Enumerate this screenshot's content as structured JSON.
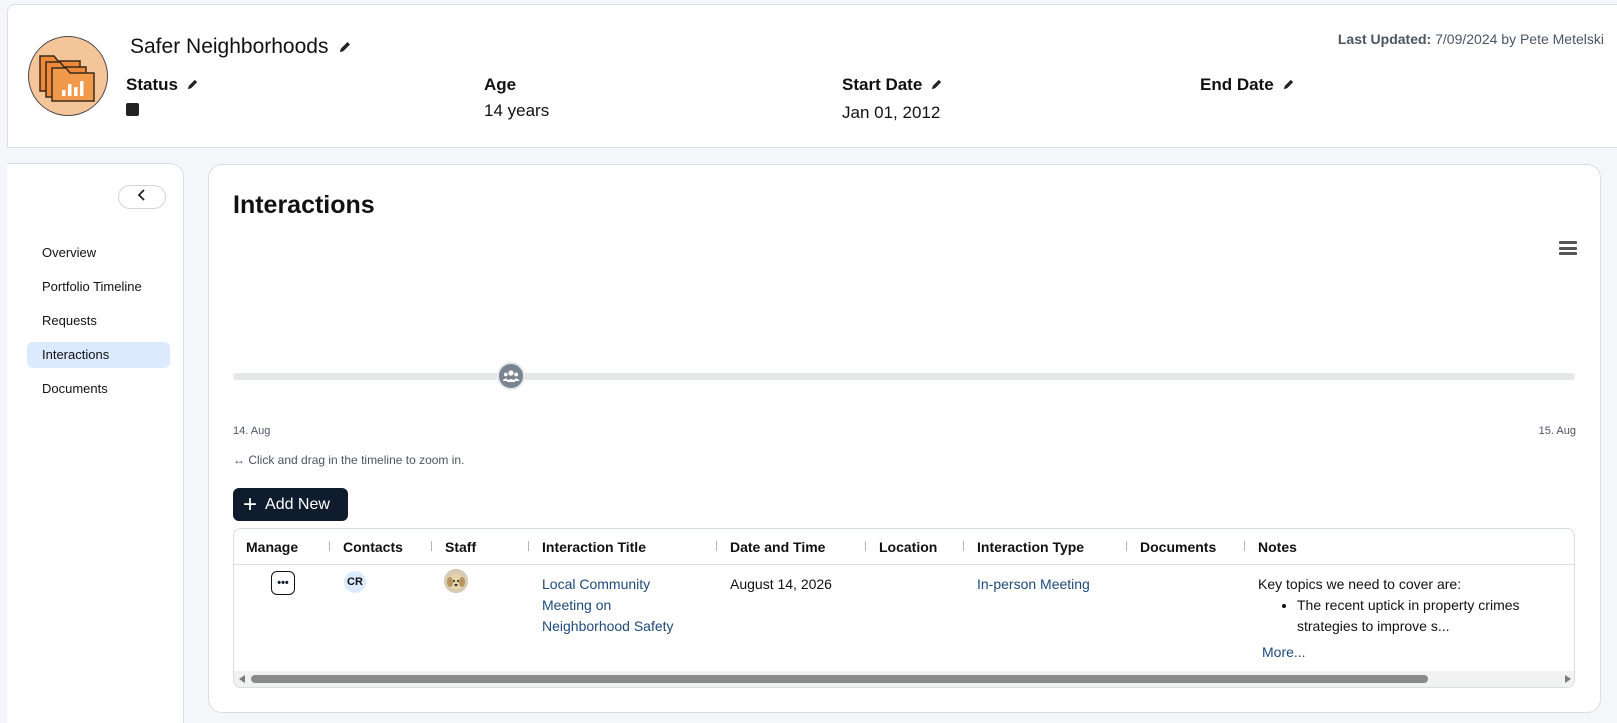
{
  "header": {
    "title": "Safer Neighborhoods",
    "last_updated_label": "Last Updated:",
    "last_updated_value": "7/09/2024 by Pete Metelski",
    "fields": {
      "status": {
        "label": "Status",
        "value": ""
      },
      "age": {
        "label": "Age",
        "value": "14 years"
      },
      "start_date": {
        "label": "Start Date",
        "value": "Jan 01, 2012"
      },
      "end_date": {
        "label": "End Date",
        "value": ""
      }
    }
  },
  "sidebar": {
    "items": [
      {
        "label": "Overview",
        "active": false
      },
      {
        "label": "Portfolio Timeline",
        "active": false
      },
      {
        "label": "Requests",
        "active": false
      },
      {
        "label": "Interactions",
        "active": true
      },
      {
        "label": "Documents",
        "active": false
      }
    ]
  },
  "main": {
    "title": "Interactions",
    "timeline": {
      "start_label": "14. Aug",
      "end_label": "15. Aug",
      "hint": "↔ Click and drag in the timeline to zoom in."
    },
    "add_new_label": "Add New",
    "table": {
      "columns": [
        "Manage",
        "Contacts",
        "Staff",
        "Interaction Title",
        "Date and Time",
        "Location",
        "Interaction Type",
        "Documents",
        "Notes"
      ],
      "rows": [
        {
          "contacts": "CR",
          "title_line1": "Local Community",
          "title_line2": "Meeting on",
          "title_line3": "Neighborhood Safety",
          "date_time": "August 14, 2026",
          "location": "",
          "interaction_type": "In-person Meeting",
          "documents": "",
          "notes_intro": "Key topics we need to cover are:",
          "notes_bullet_line1": "The recent uptick in property crimes",
          "notes_bullet_line2": "strategies to improve s...",
          "more_label": "More..."
        }
      ]
    }
  },
  "colors": {
    "accent_dark": "#0f1c2e",
    "link": "#1e4a7a",
    "active_nav": "#dbeafe",
    "logo_bg": "#f5c59a",
    "logo_folder": "#ee8a3a"
  }
}
